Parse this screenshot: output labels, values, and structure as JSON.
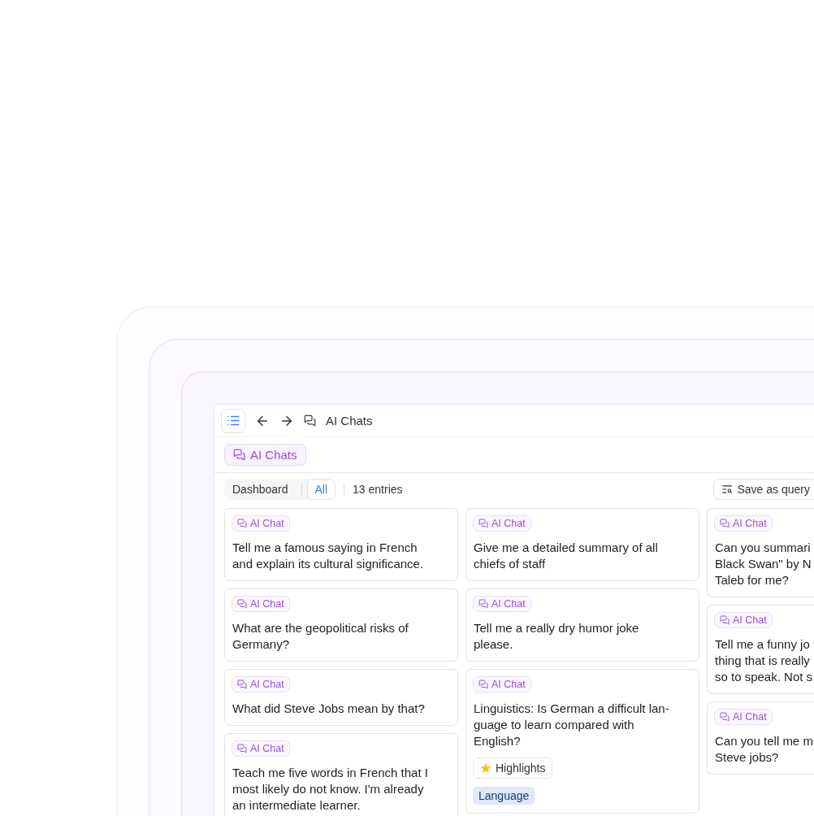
{
  "toolbar": {
    "title": "AI Chats"
  },
  "view_tag": {
    "label": "AI Chats"
  },
  "filter_bar": {
    "tabs": [
      {
        "label": "Dashboard",
        "selected": false
      },
      {
        "label": "All",
        "selected": true
      }
    ],
    "count": "13 entries",
    "save_button": "Save as query"
  },
  "columns": [
    {
      "cards": [
        {
          "tag": "AI Chat",
          "lines": [
            "Tell me a famous saying in French",
            "and explain its cultural significance."
          ]
        },
        {
          "tag": "AI Chat",
          "lines": [
            "What are the geopolitical risks of",
            "Germany?"
          ]
        },
        {
          "tag": "AI Chat",
          "lines": [
            "What did Steve Jobs mean by that?"
          ]
        },
        {
          "tag": "AI Chat",
          "lines": [
            "Teach me five words in French that I",
            "most likely do not know. I'm already",
            "an intermediate learner."
          ]
        }
      ]
    },
    {
      "cards": [
        {
          "tag": "AI Chat",
          "lines": [
            "Give me a detailed summary of all",
            "chiefs of staff"
          ]
        },
        {
          "tag": "AI Chat",
          "lines": [
            "Tell me a really dry humor joke",
            "please."
          ]
        },
        {
          "tag": "AI Chat",
          "lines": [
            "Linguistics: Is German a difficult lan-",
            "guage to learn compared with",
            "English?"
          ],
          "highlight": "Highlights",
          "labels": [
            "Language"
          ]
        }
      ]
    },
    {
      "cards": [
        {
          "tag": "AI Chat",
          "lines": [
            "Can you summari",
            "Black Swan\" by N",
            "Taleb for me?"
          ]
        },
        {
          "tag": "AI Chat",
          "lines": [
            "Tell me a funny jo",
            "thing that is really",
            "so to speak. Not s"
          ]
        },
        {
          "tag": "AI Chat",
          "lines": [
            "Can you tell me m",
            "Steve jobs?"
          ]
        }
      ]
    }
  ]
}
